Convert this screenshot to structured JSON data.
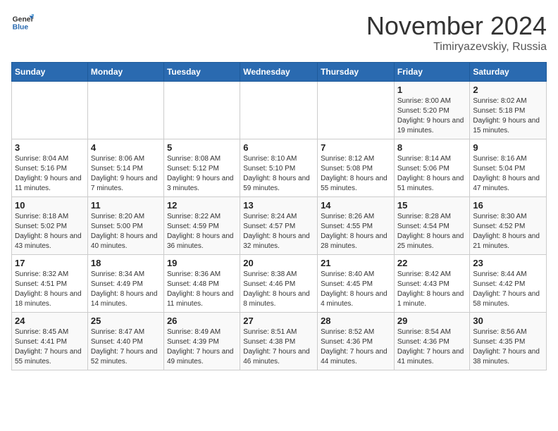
{
  "logo": {
    "line1": "General",
    "line2": "Blue"
  },
  "title": "November 2024",
  "location": "Timiryazevskiy, Russia",
  "days_of_week": [
    "Sunday",
    "Monday",
    "Tuesday",
    "Wednesday",
    "Thursday",
    "Friday",
    "Saturday"
  ],
  "weeks": [
    [
      {
        "day": "",
        "info": ""
      },
      {
        "day": "",
        "info": ""
      },
      {
        "day": "",
        "info": ""
      },
      {
        "day": "",
        "info": ""
      },
      {
        "day": "",
        "info": ""
      },
      {
        "day": "1",
        "info": "Sunrise: 8:00 AM\nSunset: 5:20 PM\nDaylight: 9 hours and 19 minutes."
      },
      {
        "day": "2",
        "info": "Sunrise: 8:02 AM\nSunset: 5:18 PM\nDaylight: 9 hours and 15 minutes."
      }
    ],
    [
      {
        "day": "3",
        "info": "Sunrise: 8:04 AM\nSunset: 5:16 PM\nDaylight: 9 hours and 11 minutes."
      },
      {
        "day": "4",
        "info": "Sunrise: 8:06 AM\nSunset: 5:14 PM\nDaylight: 9 hours and 7 minutes."
      },
      {
        "day": "5",
        "info": "Sunrise: 8:08 AM\nSunset: 5:12 PM\nDaylight: 9 hours and 3 minutes."
      },
      {
        "day": "6",
        "info": "Sunrise: 8:10 AM\nSunset: 5:10 PM\nDaylight: 8 hours and 59 minutes."
      },
      {
        "day": "7",
        "info": "Sunrise: 8:12 AM\nSunset: 5:08 PM\nDaylight: 8 hours and 55 minutes."
      },
      {
        "day": "8",
        "info": "Sunrise: 8:14 AM\nSunset: 5:06 PM\nDaylight: 8 hours and 51 minutes."
      },
      {
        "day": "9",
        "info": "Sunrise: 8:16 AM\nSunset: 5:04 PM\nDaylight: 8 hours and 47 minutes."
      }
    ],
    [
      {
        "day": "10",
        "info": "Sunrise: 8:18 AM\nSunset: 5:02 PM\nDaylight: 8 hours and 43 minutes."
      },
      {
        "day": "11",
        "info": "Sunrise: 8:20 AM\nSunset: 5:00 PM\nDaylight: 8 hours and 40 minutes."
      },
      {
        "day": "12",
        "info": "Sunrise: 8:22 AM\nSunset: 4:59 PM\nDaylight: 8 hours and 36 minutes."
      },
      {
        "day": "13",
        "info": "Sunrise: 8:24 AM\nSunset: 4:57 PM\nDaylight: 8 hours and 32 minutes."
      },
      {
        "day": "14",
        "info": "Sunrise: 8:26 AM\nSunset: 4:55 PM\nDaylight: 8 hours and 28 minutes."
      },
      {
        "day": "15",
        "info": "Sunrise: 8:28 AM\nSunset: 4:54 PM\nDaylight: 8 hours and 25 minutes."
      },
      {
        "day": "16",
        "info": "Sunrise: 8:30 AM\nSunset: 4:52 PM\nDaylight: 8 hours and 21 minutes."
      }
    ],
    [
      {
        "day": "17",
        "info": "Sunrise: 8:32 AM\nSunset: 4:51 PM\nDaylight: 8 hours and 18 minutes."
      },
      {
        "day": "18",
        "info": "Sunrise: 8:34 AM\nSunset: 4:49 PM\nDaylight: 8 hours and 14 minutes."
      },
      {
        "day": "19",
        "info": "Sunrise: 8:36 AM\nSunset: 4:48 PM\nDaylight: 8 hours and 11 minutes."
      },
      {
        "day": "20",
        "info": "Sunrise: 8:38 AM\nSunset: 4:46 PM\nDaylight: 8 hours and 8 minutes."
      },
      {
        "day": "21",
        "info": "Sunrise: 8:40 AM\nSunset: 4:45 PM\nDaylight: 8 hours and 4 minutes."
      },
      {
        "day": "22",
        "info": "Sunrise: 8:42 AM\nSunset: 4:43 PM\nDaylight: 8 hours and 1 minute."
      },
      {
        "day": "23",
        "info": "Sunrise: 8:44 AM\nSunset: 4:42 PM\nDaylight: 7 hours and 58 minutes."
      }
    ],
    [
      {
        "day": "24",
        "info": "Sunrise: 8:45 AM\nSunset: 4:41 PM\nDaylight: 7 hours and 55 minutes."
      },
      {
        "day": "25",
        "info": "Sunrise: 8:47 AM\nSunset: 4:40 PM\nDaylight: 7 hours and 52 minutes."
      },
      {
        "day": "26",
        "info": "Sunrise: 8:49 AM\nSunset: 4:39 PM\nDaylight: 7 hours and 49 minutes."
      },
      {
        "day": "27",
        "info": "Sunrise: 8:51 AM\nSunset: 4:38 PM\nDaylight: 7 hours and 46 minutes."
      },
      {
        "day": "28",
        "info": "Sunrise: 8:52 AM\nSunset: 4:36 PM\nDaylight: 7 hours and 44 minutes."
      },
      {
        "day": "29",
        "info": "Sunrise: 8:54 AM\nSunset: 4:36 PM\nDaylight: 7 hours and 41 minutes."
      },
      {
        "day": "30",
        "info": "Sunrise: 8:56 AM\nSunset: 4:35 PM\nDaylight: 7 hours and 38 minutes."
      }
    ]
  ]
}
